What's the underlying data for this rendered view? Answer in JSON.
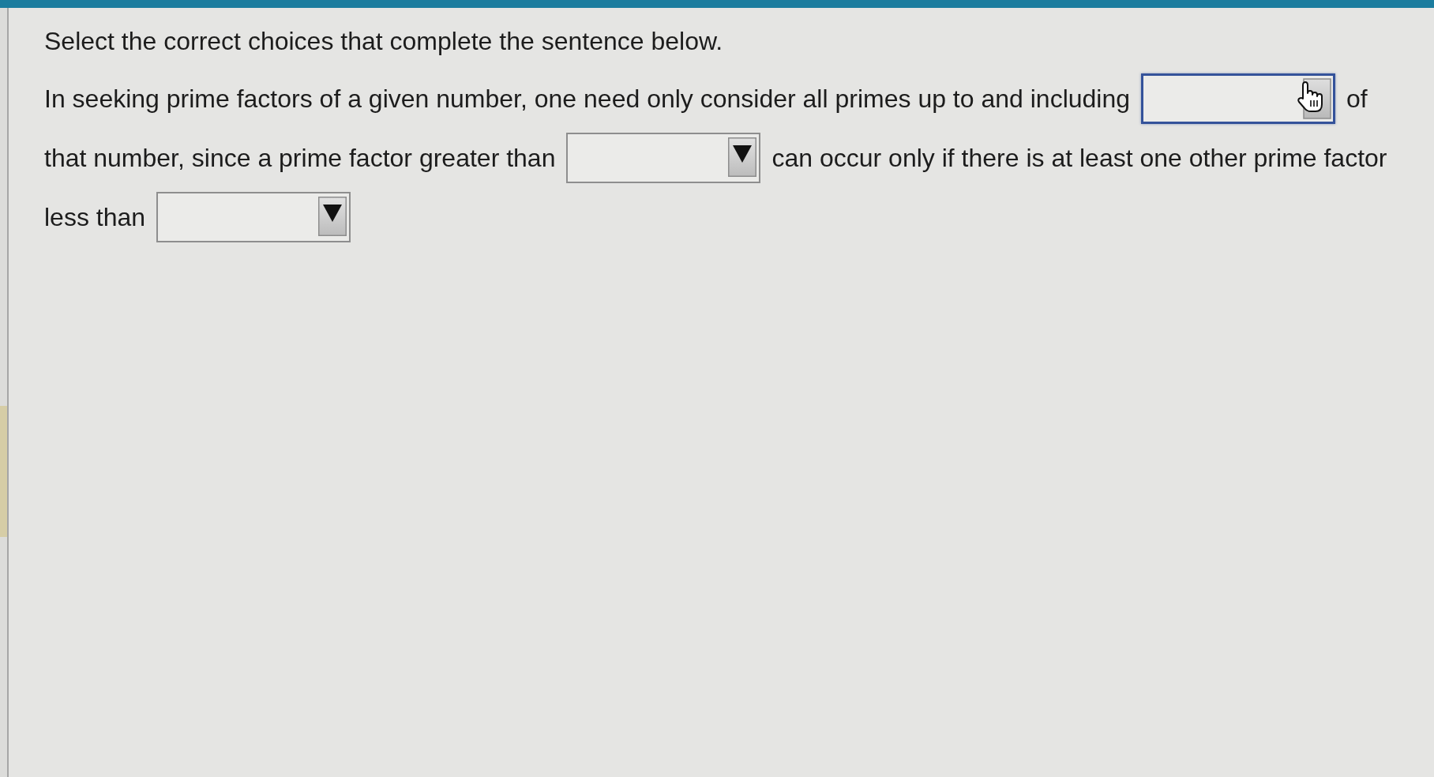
{
  "instruction": "Select the correct choices that complete the sentence below.",
  "sentence_lines": [
    [
      {
        "kind": "text",
        "text": "In seeking prime factors of a given number, one need only consider all primes up to and including"
      },
      {
        "kind": "dropdown",
        "focused": true,
        "hovered": true
      },
      {
        "kind": "text",
        "text": "of"
      }
    ],
    [
      {
        "kind": "text",
        "text": "that number, since a prime factor greater than"
      },
      {
        "kind": "dropdown",
        "focused": false,
        "hovered": false
      },
      {
        "kind": "text",
        "text": "can occur only if there is at least one other prime factor"
      }
    ],
    [
      {
        "kind": "text",
        "text": "less than"
      },
      {
        "kind": "dropdown",
        "focused": false,
        "hovered": false
      }
    ]
  ]
}
